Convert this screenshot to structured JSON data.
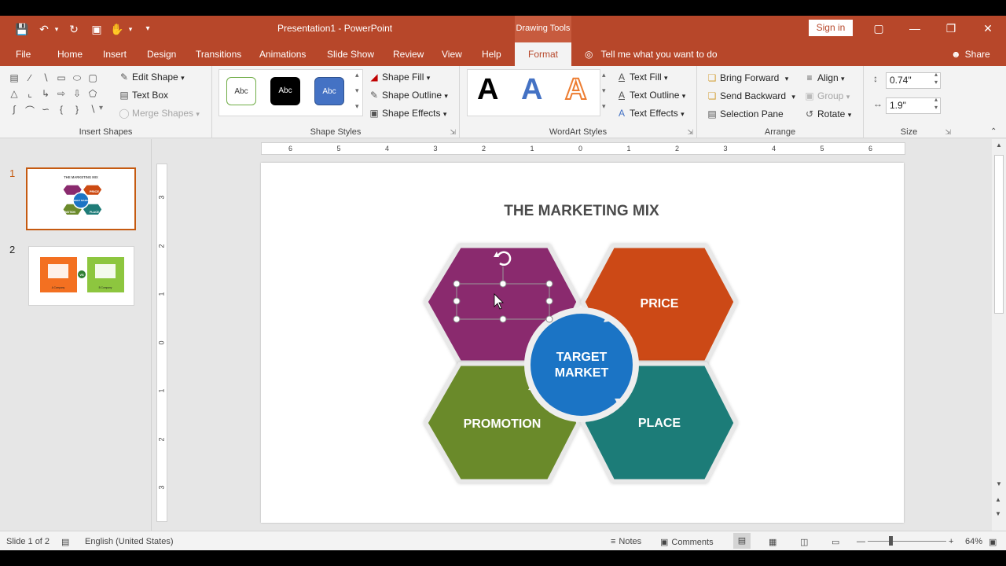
{
  "window": {
    "title": "Presentation1  -  PowerPoint",
    "contextual_tab_group": "Drawing Tools",
    "sign_in": "Sign in"
  },
  "menu": {
    "items": [
      "File",
      "Home",
      "Insert",
      "Design",
      "Transitions",
      "Animations",
      "Slide Show",
      "Review",
      "View",
      "Help"
    ],
    "active_tab": "Format",
    "tell_me": "Tell me what you want to do",
    "share": "Share"
  },
  "ribbon": {
    "insert_shapes": {
      "label": "Insert Shapes",
      "edit_shape": "Edit Shape",
      "text_box": "Text Box",
      "merge_shapes": "Merge Shapes"
    },
    "shape_styles": {
      "label": "Shape Styles",
      "swatch_text": "Abc",
      "shape_fill": "Shape Fill",
      "shape_outline": "Shape Outline",
      "shape_effects": "Shape Effects"
    },
    "wordart_styles": {
      "label": "WordArt Styles",
      "glyph": "A",
      "text_fill": "Text Fill",
      "text_outline": "Text Outline",
      "text_effects": "Text Effects"
    },
    "arrange": {
      "label": "Arrange",
      "bring_forward": "Bring Forward",
      "send_backward": "Send Backward",
      "selection_pane": "Selection Pane",
      "align": "Align",
      "group": "Group",
      "rotate": "Rotate"
    },
    "size": {
      "label": "Size",
      "height": "0.74\"",
      "width": "1.9\""
    }
  },
  "thumbnails": [
    {
      "number": "1",
      "title": "THE MARKETING MIX",
      "labels": [
        "PRICE",
        "TARGET MARKET",
        "PROMOTION",
        "PLACE"
      ]
    },
    {
      "number": "2",
      "left_label": "A Company",
      "right_label": "B Company",
      "vs": "VS"
    }
  ],
  "ruler": {
    "h_marks": [
      "6",
      "5",
      "4",
      "3",
      "2",
      "1",
      "0",
      "1",
      "2",
      "3",
      "4",
      "5",
      "6"
    ],
    "v_marks": [
      "3",
      "2",
      "1",
      "0",
      "1",
      "2",
      "3"
    ]
  },
  "slide": {
    "title": "THE MARKETING MIX",
    "hex_price": "PRICE",
    "hex_promotion": "PROMOTION",
    "hex_place": "PLACE",
    "center_line1": "TARGET",
    "center_line2": "MARKET",
    "colors": {
      "purple": "#8a2a6e",
      "orange": "#cc4a12",
      "green": "#6b8a2b",
      "teal": "#1f7c78",
      "blue": "#1b74c5"
    }
  },
  "status": {
    "slide_of": "Slide 1 of 2",
    "language": "English (United States)",
    "notes": "Notes",
    "comments": "Comments",
    "zoom": "64%"
  }
}
